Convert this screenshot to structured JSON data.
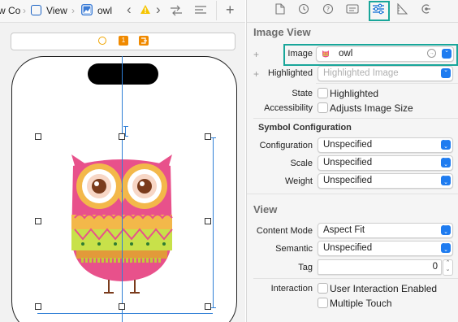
{
  "jumpbar": {
    "crumb1": "w Co",
    "crumb2": "View",
    "crumb3": "owl"
  },
  "inspector": {
    "image_view": {
      "section_title": "Image View",
      "image_label": "Image",
      "image_value": "owl",
      "highlighted_label": "Highlighted",
      "highlighted_placeholder": "Highlighted Image",
      "state_label": "State",
      "state_option": "Highlighted",
      "accessibility_label": "Accessibility",
      "accessibility_option": "Adjusts Image Size",
      "symbol_config_title": "Symbol Configuration",
      "configuration_label": "Configuration",
      "configuration_value": "Unspecified",
      "scale_label": "Scale",
      "scale_value": "Unspecified",
      "weight_label": "Weight",
      "weight_value": "Unspecified"
    },
    "view": {
      "section_title": "View",
      "content_mode_label": "Content Mode",
      "content_mode_value": "Aspect Fit",
      "semantic_label": "Semantic",
      "semantic_value": "Unspecified",
      "tag_label": "Tag",
      "tag_value": "0",
      "interaction_label": "Interaction",
      "interaction_opt1": "User Interaction Enabled",
      "interaction_opt2": "Multiple Touch"
    }
  },
  "colors": {
    "highlight": "#19a69a",
    "accent": "#1f7cf0",
    "owl_body": "#e8518b",
    "owl_belly": "#f3b84a",
    "owl_stripe": "#c8e14a"
  }
}
